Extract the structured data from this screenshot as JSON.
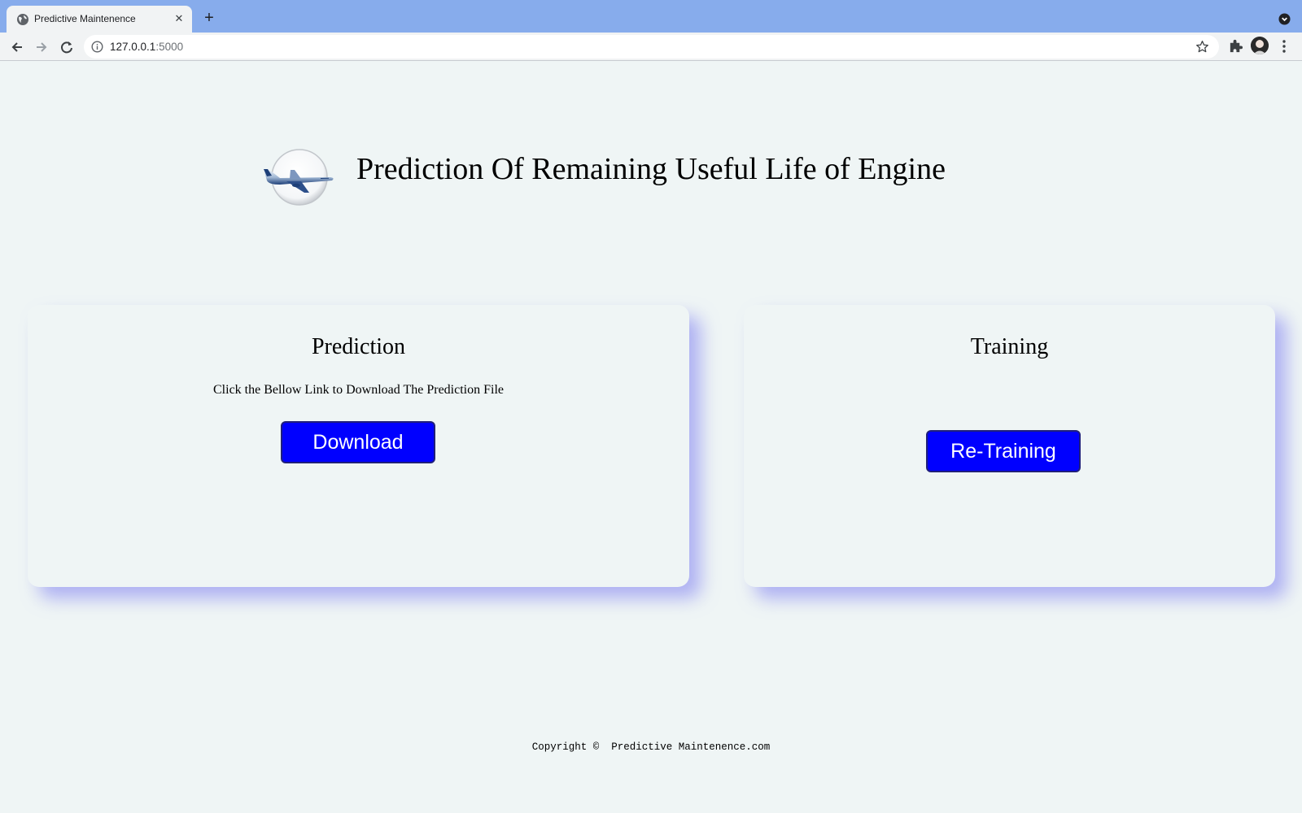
{
  "browser": {
    "tab_title": "Predictive Maintenence",
    "url_host": "127.0.0.1",
    "url_port": ":5000"
  },
  "header": {
    "title": "Prediction Of Remaining Useful Life of Engine",
    "logo_icon": "airplane-icon"
  },
  "prediction_card": {
    "title": "Prediction",
    "description": "Click the Bellow Link to Download The Prediction File",
    "button_label": "Download"
  },
  "training_card": {
    "title": "Training",
    "button_label": "Re-Training"
  },
  "footer": {
    "text": "Copyright ©  Predictive Maintenence.com"
  },
  "colors": {
    "tabstrip": "#87acec",
    "page_background": "#eff5f5",
    "button": "#0000ff",
    "card_shadow": "#7878f0"
  }
}
